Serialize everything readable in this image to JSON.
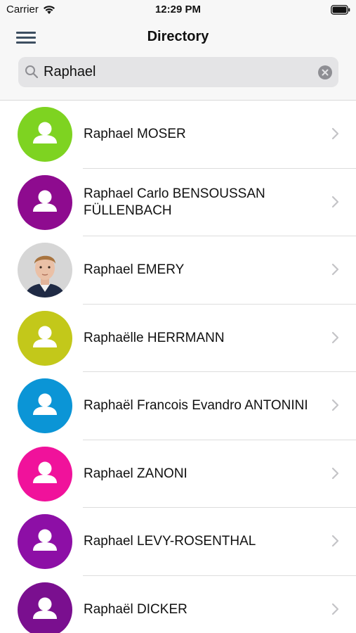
{
  "status_bar": {
    "carrier": "Carrier",
    "time": "12:29 PM",
    "wifi_icon": "wifi-icon",
    "battery_icon": "battery-icon"
  },
  "nav": {
    "title": "Directory",
    "menu_icon": "hamburger-menu-icon"
  },
  "search": {
    "value": "Raphael",
    "search_icon": "magnifier-icon",
    "clear_icon": "clear-circle-icon"
  },
  "contacts": [
    {
      "name": "Raphael MOSER",
      "avatar_type": "placeholder",
      "avatar_color": "#7ed321"
    },
    {
      "name": "Raphael Carlo BENSOUSSAN FÜLLENBACH",
      "avatar_type": "placeholder",
      "avatar_color": "#8e0b8f"
    },
    {
      "name": "Raphael EMERY",
      "avatar_type": "photo",
      "avatar_color": "#c9c9c9"
    },
    {
      "name": "Raphaëlle HERRMANN",
      "avatar_type": "placeholder",
      "avatar_color": "#c3c81a"
    },
    {
      "name": "Raphaël Francois Evandro ANTONINI",
      "avatar_type": "placeholder",
      "avatar_color": "#0b95d6"
    },
    {
      "name": "Raphael ZANONI",
      "avatar_type": "placeholder",
      "avatar_color": "#f0129b"
    },
    {
      "name": "Raphael LEVY-ROSENTHAL",
      "avatar_type": "placeholder",
      "avatar_color": "#8d0fa6"
    },
    {
      "name": "Raphaël DICKER",
      "avatar_type": "placeholder",
      "avatar_color": "#7a0f8f"
    }
  ],
  "colors": {
    "header_background": "#f7f7f7",
    "search_background": "#e4e4e6",
    "chevron": "#c4c4c7",
    "divider": "#dddddd"
  }
}
